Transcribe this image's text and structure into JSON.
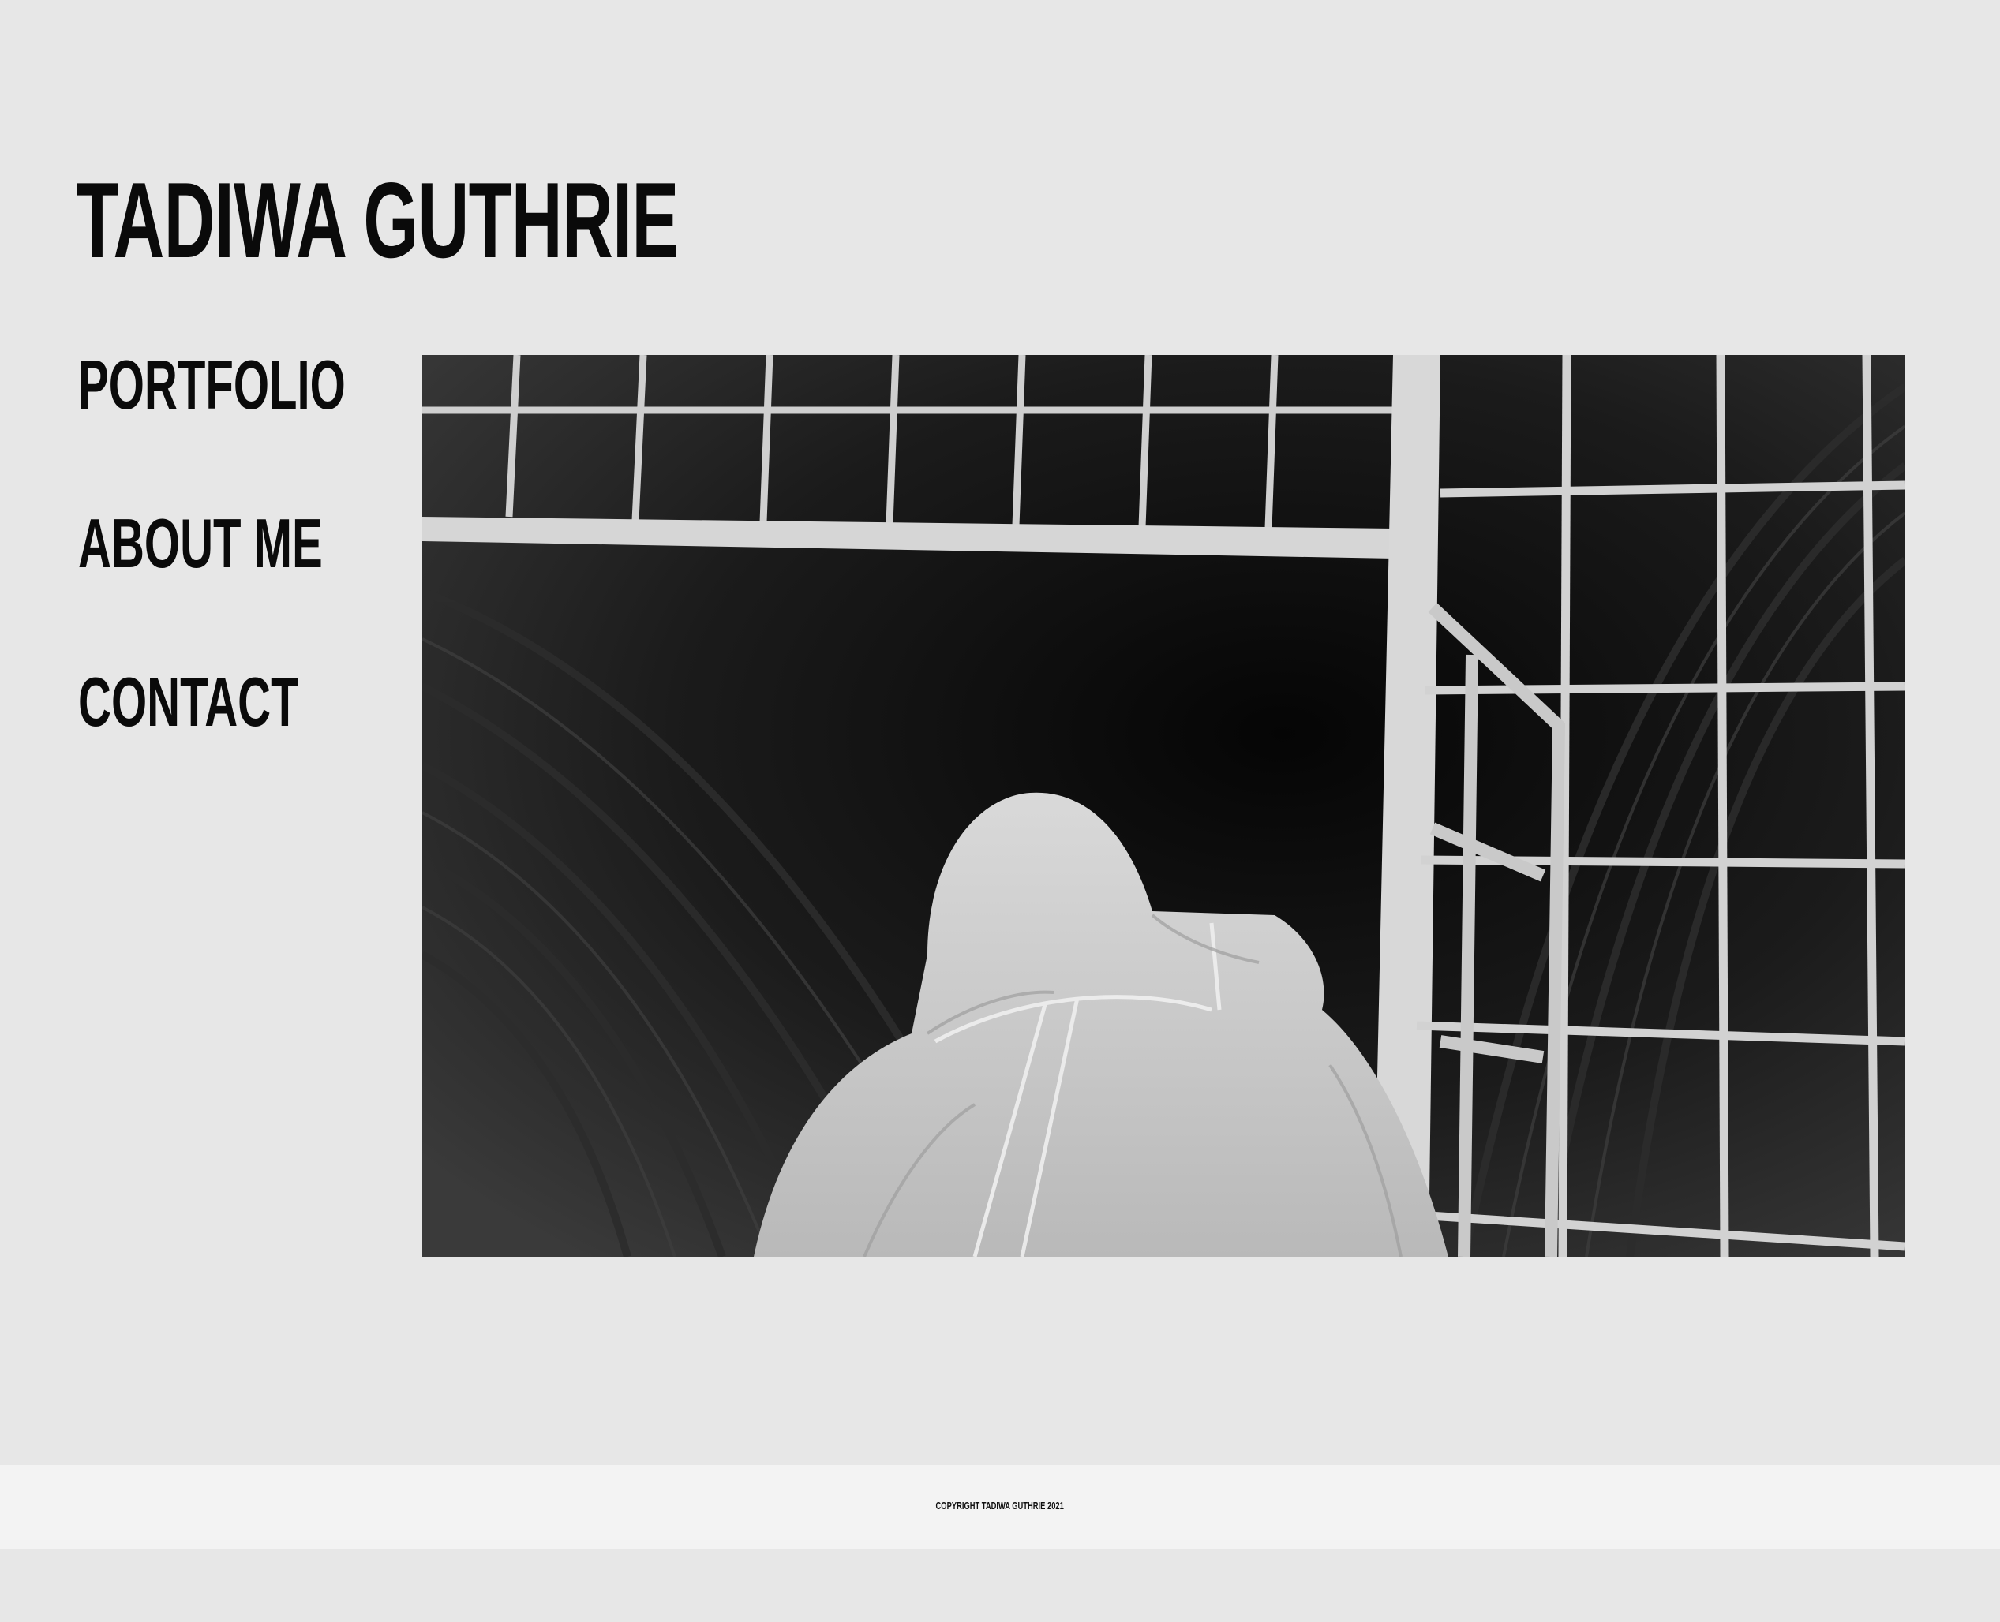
{
  "site": {
    "title": "TADIWA GUTHRIE"
  },
  "nav": {
    "items": [
      {
        "label": "PORTFOLIO"
      },
      {
        "label": "ABOUT ME"
      },
      {
        "label": "CONTACT"
      }
    ]
  },
  "hero": {
    "image": "black-and-white photo of a hooded figure facing a metal gate in a dark tunnel"
  },
  "footer": {
    "copyright": "COPYRIGHT TADIWA GUTHRIE 2021"
  },
  "colors": {
    "background": "#e7e7e7",
    "footer_background": "#f3f3f3",
    "text": "#0a0a0a"
  }
}
